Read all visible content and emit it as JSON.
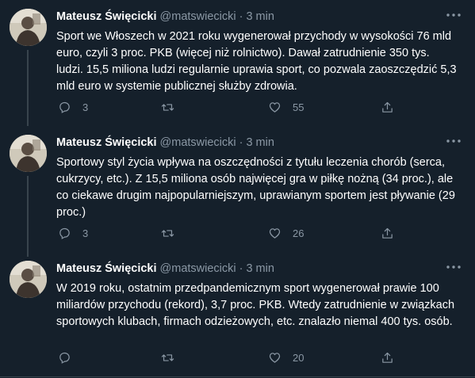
{
  "tweets": [
    {
      "name": "Mateusz Święcicki",
      "handle": "@matswiecicki",
      "dot": "·",
      "time": "3 min",
      "text": "Sport we Włoszech w 2021 roku wygenerował przychody w wysokości 76 mld euro, czyli 3 proc. PKB (więcej niż rolnictwo). Dawał zatrudnienie 350 tys. ludzi. 15,5 miliona ludzi regularnie uprawia sport, co pozwala zaoszczędzić 5,3 mld euro w systemie publicznej służby zdrowia.",
      "replies": "3",
      "retweets": "",
      "likes": "55"
    },
    {
      "name": "Mateusz Święcicki",
      "handle": "@matswiecicki",
      "dot": "·",
      "time": "3 min",
      "text": "Sportowy styl życia wpływa na oszczędności z tytułu leczenia chorób (serca, cukrzycy, etc.). Z 15,5 miliona osób najwięcej gra w piłkę nożną (34 proc.), ale co ciekawe drugim najpopularniejszym, uprawianym sportem jest pływanie (29 proc.)",
      "replies": "3",
      "retweets": "",
      "likes": "26"
    },
    {
      "name": "Mateusz Święcicki",
      "handle": "@matswiecicki",
      "dot": "·",
      "time": "3 min",
      "text": "W 2019 roku, ostatnim przedpandemicznym sport wygenerował prawie 100 miliardów przychodu (rekord), 3,7 proc. PKB. Wtedy zatrudnienie w związkach sportowych klubach, firmach odzieżowych, etc. znalazło niemal 400 tys. osób.",
      "replies": "",
      "retweets": "",
      "likes": "20"
    }
  ],
  "icons": {
    "reply": "reply-icon",
    "retweet": "retweet-icon",
    "like": "like-icon",
    "share": "share-icon",
    "more": "more-icon"
  },
  "colors": {
    "background": "#15202b",
    "secondary_text": "#8b98a5",
    "divider": "#38444d",
    "primary_text": "#ffffff"
  }
}
